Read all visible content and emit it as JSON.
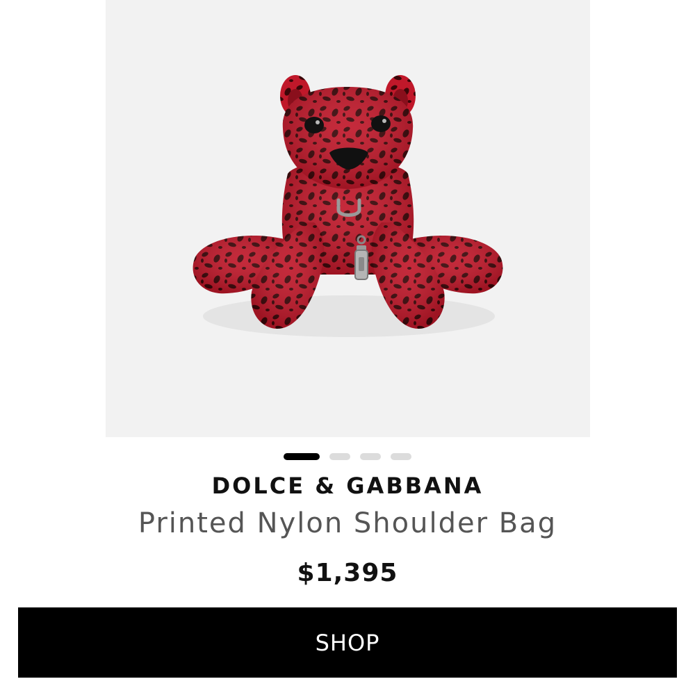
{
  "product": {
    "brand": "DOLCE & GABBANA",
    "name": "Printed Nylon Shoulder Bag",
    "price": "$1,395",
    "image_icon": "leopard-plush-bag-image"
  },
  "carousel": {
    "total": 4,
    "active_index": 0
  },
  "cta": {
    "label": "SHOP"
  },
  "colors": {
    "button_bg": "#000000",
    "button_text": "#ffffff",
    "image_bg": "#f2f2f2",
    "product_red": "#c0182a",
    "spot": "#3a0608"
  }
}
